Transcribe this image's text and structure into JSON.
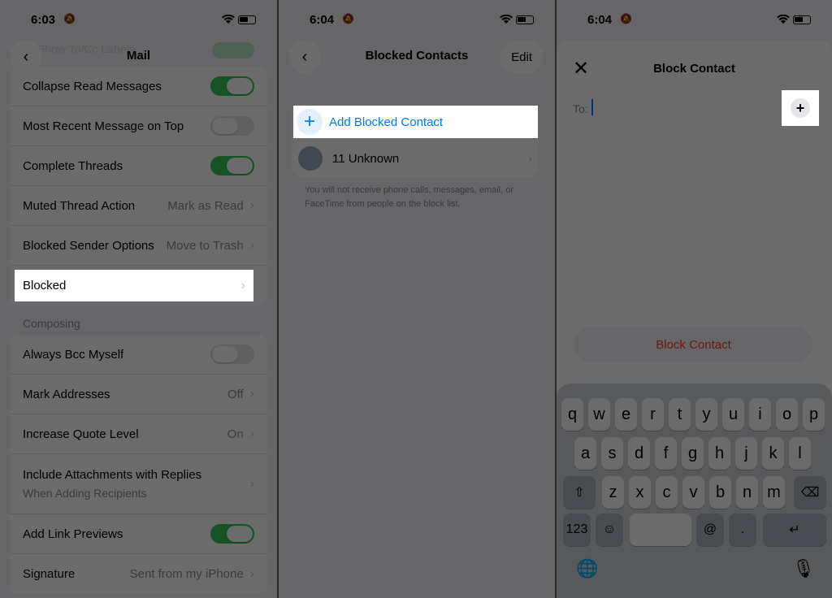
{
  "panel1": {
    "status": {
      "time": "6:03",
      "bell": "🔕"
    },
    "back_icon": "‹",
    "ghost_row": "Show To/Cc Labels",
    "nav_title": "Mail",
    "rows_top": [
      {
        "label": "Collapse Read Messages",
        "toggle": "on"
      },
      {
        "label": "Most Recent Message on Top",
        "toggle": "off"
      },
      {
        "label": "Complete Threads",
        "toggle": "on"
      },
      {
        "label": "Muted Thread Action",
        "value": "Mark as Read"
      },
      {
        "label": "Blocked Sender Options",
        "value": "Move to Trash"
      }
    ],
    "blocked_label": "Blocked",
    "composing_header": "Composing",
    "rows_composing": [
      {
        "label": "Always Bcc Myself",
        "toggle": "off"
      },
      {
        "label": "Mark Addresses",
        "value": "Off"
      },
      {
        "label": "Increase Quote Level",
        "value": "On"
      }
    ],
    "attachments": {
      "label": "Include Attachments with Replies",
      "sub": "When Adding Recipients"
    },
    "rows_bottom": [
      {
        "label": "Add Link Previews",
        "toggle": "on"
      },
      {
        "label": "Signature",
        "value": "Sent from my iPhone"
      }
    ],
    "chevron": "›"
  },
  "panel2": {
    "status": {
      "time": "6:04",
      "bell": "🔕"
    },
    "back_icon": "‹",
    "nav_title": "Blocked Contacts",
    "edit_label": "Edit",
    "add_label": "Add Blocked Contact",
    "plus_icon": "+",
    "unknown_label": "11 Unknown",
    "footnote": "You will not receive phone calls, messages, email, or FaceTime from people on the block list.",
    "chevron": "›"
  },
  "panel3": {
    "status": {
      "time": "6:04",
      "bell": "🔕"
    },
    "close_icon": "✕",
    "title": "Block Contact",
    "to_label": "To:",
    "plus_icon": "+",
    "block_button": "Block Contact",
    "keyboard": {
      "row1": [
        "q",
        "w",
        "e",
        "r",
        "t",
        "y",
        "u",
        "i",
        "o",
        "p"
      ],
      "row2": [
        "a",
        "s",
        "d",
        "f",
        "g",
        "h",
        "j",
        "k",
        "l"
      ],
      "row3": [
        "z",
        "x",
        "c",
        "v",
        "b",
        "n",
        "m"
      ],
      "shift_icon": "⇧",
      "delete_icon": "⌫",
      "numbers": "123",
      "emoji_icon": "☺",
      "at": "@",
      "dot": ".",
      "return_icon": "↵",
      "globe_icon": "🌐",
      "mic_icon": "🎙"
    }
  }
}
